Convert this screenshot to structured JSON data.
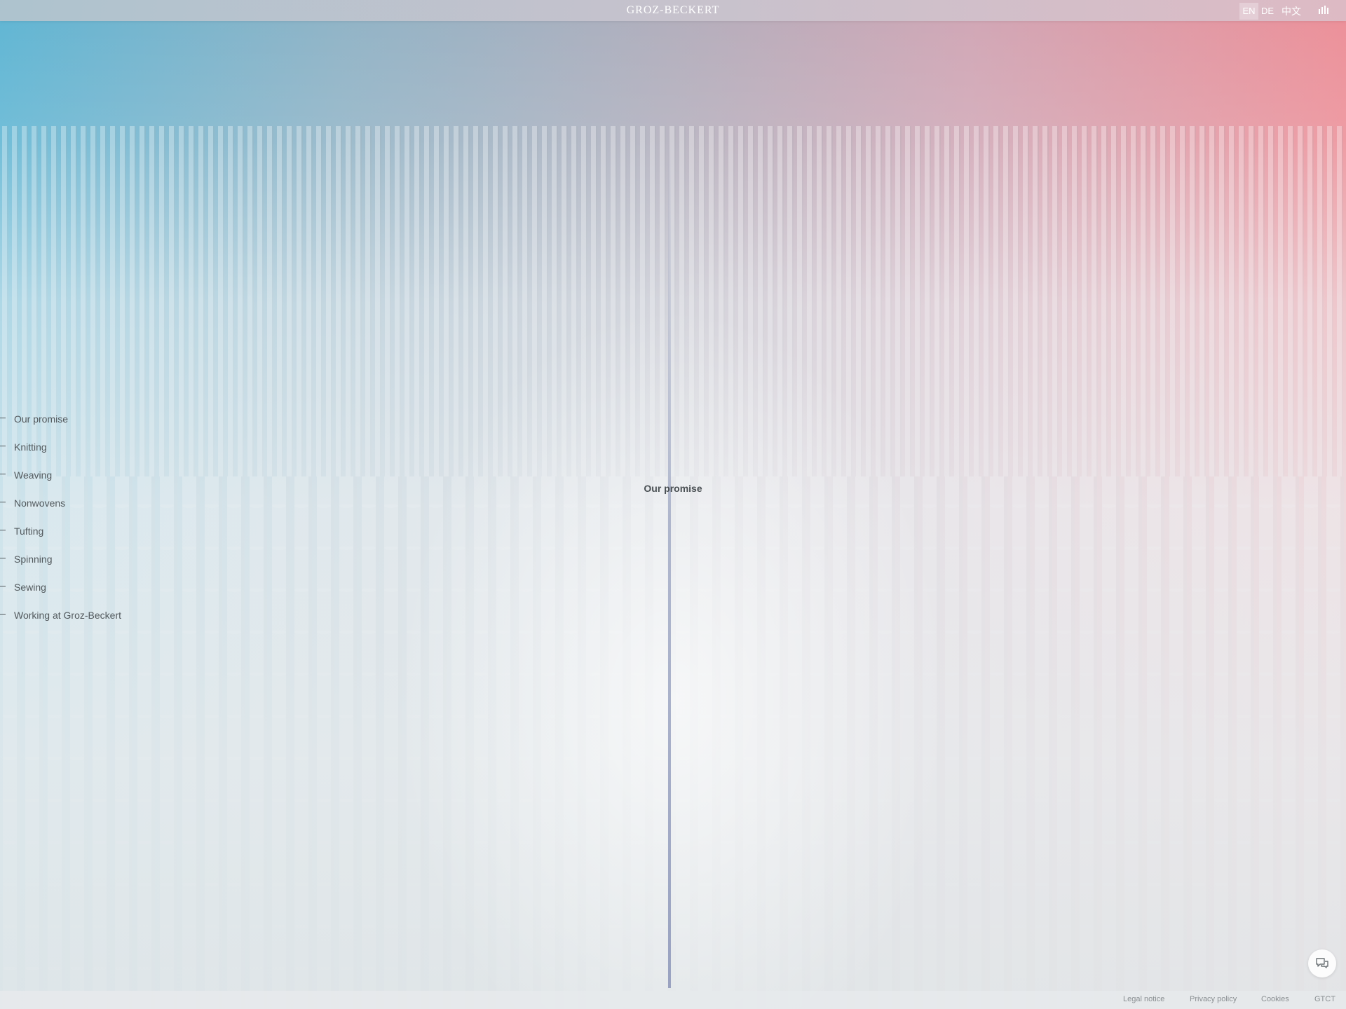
{
  "header": {
    "brand": "GROZ-BECKERT",
    "languages": [
      {
        "label": "EN",
        "active": true
      },
      {
        "label": "DE",
        "active": false
      },
      {
        "label": "中文",
        "active": false
      }
    ],
    "menu_icon": "bars-icon"
  },
  "sidenav": {
    "items": [
      {
        "label": "Our promise"
      },
      {
        "label": "Knitting"
      },
      {
        "label": "Weaving"
      },
      {
        "label": "Nonwovens"
      },
      {
        "label": "Tufting"
      },
      {
        "label": "Spinning"
      },
      {
        "label": "Sewing"
      },
      {
        "label": "Working at Groz-Beckert"
      }
    ]
  },
  "main": {
    "section_title": "Our promise"
  },
  "chat": {
    "icon": "chat-bubbles-icon"
  },
  "footer": {
    "links": [
      {
        "label": "Legal notice"
      },
      {
        "label": "Privacy policy"
      },
      {
        "label": "Cookies"
      },
      {
        "label": "GTCT"
      }
    ]
  },
  "colors": {
    "gradient_left": "#5fb5d3",
    "gradient_right": "#ec8f98",
    "text": "#52595d"
  }
}
